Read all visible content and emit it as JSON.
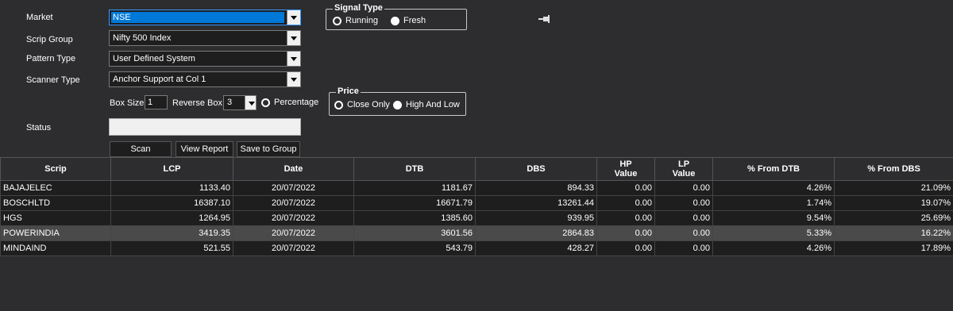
{
  "form": {
    "market_label": "Market",
    "market_value": "NSE",
    "scrip_group_label": "Scrip Group",
    "scrip_group_value": "Nifty 500 Index",
    "pattern_type_label": "Pattern Type",
    "pattern_type_value": "User Defined System",
    "scanner_type_label": "Scanner Type",
    "scanner_type_value": "Anchor Support at Col 1",
    "box_size_label": "Box Size",
    "box_size_value": "1",
    "reverse_box_label": "Reverse Box",
    "reverse_box_value": "3",
    "percentage_label": "Percentage",
    "status_label": "Status",
    "status_value": ""
  },
  "signal_type": {
    "title": "Signal Type",
    "running_label": "Running",
    "fresh_label": "Fresh",
    "selected": "Fresh"
  },
  "price": {
    "title": "Price",
    "close_only_label": "Close Only",
    "high_low_label": "High And Low",
    "selected": "High And Low"
  },
  "buttons": {
    "scan": "Scan",
    "view_report": "View Report",
    "save_to_group": "Save to Group"
  },
  "icons": {
    "pin": "pin-icon"
  },
  "table": {
    "headers": [
      "Scrip",
      "LCP",
      "Date",
      "DTB",
      "DBS",
      "HP\nValue",
      "LP\nValue",
      "% From DTB",
      "% From DBS"
    ],
    "rows": [
      [
        "BAJAJELEC",
        "1133.40",
        "20/07/2022",
        "1181.67",
        "894.33",
        "0.00",
        "0.00",
        "4.26%",
        "21.09%"
      ],
      [
        "BOSCHLTD",
        "16387.10",
        "20/07/2022",
        "16671.79",
        "13261.44",
        "0.00",
        "0.00",
        "1.74%",
        "19.07%"
      ],
      [
        "HGS",
        "1264.95",
        "20/07/2022",
        "1385.60",
        "939.95",
        "0.00",
        "0.00",
        "9.54%",
        "25.69%"
      ],
      [
        "POWERINDIA",
        "3419.35",
        "20/07/2022",
        "3601.56",
        "2864.83",
        "0.00",
        "0.00",
        "5.33%",
        "16.22%"
      ],
      [
        "MINDAIND",
        "521.55",
        "20/07/2022",
        "543.79",
        "428.27",
        "0.00",
        "0.00",
        "4.26%",
        "17.89%"
      ]
    ],
    "selected_row": 3
  },
  "colors": {
    "background": "#2d2d30",
    "selection": "#0078d7",
    "row_selected": "#4a4a4a"
  }
}
